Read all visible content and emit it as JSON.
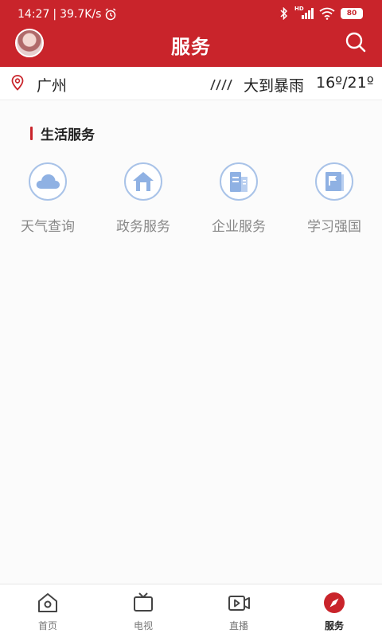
{
  "status_bar": {
    "time": "14:27",
    "separator": "|",
    "net_speed": "39.7K/s",
    "network": "HD",
    "battery": "80"
  },
  "header": {
    "title": "服务"
  },
  "location": {
    "city": "广州",
    "weather": "大到暴雨",
    "temperature": "16º/21º"
  },
  "section": {
    "title": "生活服务",
    "services": [
      {
        "label": "天气查询",
        "icon": "cloud-icon"
      },
      {
        "label": "政务服务",
        "icon": "house-icon"
      },
      {
        "label": "企业服务",
        "icon": "building-icon"
      },
      {
        "label": "学习强国",
        "icon": "flag-book-icon"
      }
    ]
  },
  "nav": {
    "items": [
      {
        "label": "首页",
        "icon": "home-icon"
      },
      {
        "label": "电视",
        "icon": "tv-icon"
      },
      {
        "label": "直播",
        "icon": "live-video-icon"
      },
      {
        "label": "服务",
        "icon": "compass-icon"
      }
    ],
    "active_index": 3
  },
  "colors": {
    "brand": "#c9242b",
    "icon_blue": "#8fb1e3",
    "text_muted": "#888888"
  }
}
